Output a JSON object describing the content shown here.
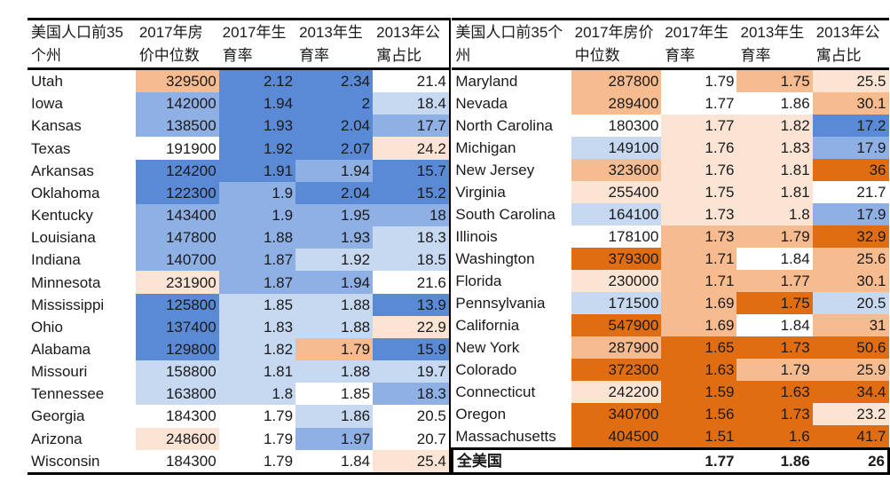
{
  "palette": {
    "D": "#5a8ad5",
    "M": "#8fb0e4",
    "L": "#c7d8f1",
    "W": "#ffffff",
    "P": "#fce4d5",
    "O": "#f6bb8f",
    "R": "#e06d12"
  },
  "chart_data": {
    "type": "table",
    "left": {
      "headers": [
        [
          "美国人口前35",
          "个州"
        ],
        [
          "2017年房",
          "价中位数"
        ],
        [
          "2017年生",
          "育率"
        ],
        [
          "2013年生",
          "育率"
        ],
        [
          "2013年公",
          "寓占比"
        ]
      ],
      "rows": [
        {
          "name": "Utah",
          "values": [
            "329500",
            "2.12",
            "2.34",
            "21.4"
          ],
          "colors": [
            "O",
            "D",
            "D",
            "W"
          ]
        },
        {
          "name": "Iowa",
          "values": [
            "142000",
            "1.94",
            "2",
            "18.4"
          ],
          "colors": [
            "M",
            "D",
            "D",
            "L"
          ]
        },
        {
          "name": "Kansas",
          "values": [
            "138500",
            "1.93",
            "2.04",
            "17.7"
          ],
          "colors": [
            "M",
            "D",
            "D",
            "M"
          ]
        },
        {
          "name": "Texas",
          "values": [
            "191900",
            "1.92",
            "2.07",
            "24.2"
          ],
          "colors": [
            "W",
            "D",
            "D",
            "P"
          ]
        },
        {
          "name": "Arkansas",
          "values": [
            "124200",
            "1.91",
            "1.94",
            "15.7"
          ],
          "colors": [
            "D",
            "D",
            "M",
            "D"
          ]
        },
        {
          "name": "Oklahoma",
          "values": [
            "122300",
            "1.9",
            "2.04",
            "15.2"
          ],
          "colors": [
            "D",
            "M",
            "D",
            "D"
          ]
        },
        {
          "name": "Kentucky",
          "values": [
            "143400",
            "1.9",
            "1.95",
            "18"
          ],
          "colors": [
            "M",
            "M",
            "M",
            "M"
          ]
        },
        {
          "name": "Louisiana",
          "values": [
            "147800",
            "1.88",
            "1.93",
            "18.3"
          ],
          "colors": [
            "M",
            "M",
            "M",
            "L"
          ]
        },
        {
          "name": "Indiana",
          "values": [
            "140700",
            "1.87",
            "1.92",
            "18.5"
          ],
          "colors": [
            "M",
            "M",
            "L",
            "L"
          ]
        },
        {
          "name": "Minnesota",
          "values": [
            "231900",
            "1.87",
            "1.94",
            "21.6"
          ],
          "colors": [
            "P",
            "M",
            "M",
            "W"
          ]
        },
        {
          "name": "Mississippi",
          "values": [
            "125800",
            "1.85",
            "1.88",
            "13.9"
          ],
          "colors": [
            "D",
            "L",
            "L",
            "D"
          ]
        },
        {
          "name": "Ohio",
          "values": [
            "137400",
            "1.83",
            "1.88",
            "22.9"
          ],
          "colors": [
            "D",
            "L",
            "L",
            "P"
          ]
        },
        {
          "name": "Alabama",
          "values": [
            "129800",
            "1.82",
            "1.79",
            "15.9"
          ],
          "colors": [
            "D",
            "L",
            "O",
            "D"
          ]
        },
        {
          "name": "Missouri",
          "values": [
            "158800",
            "1.81",
            "1.88",
            "19.7"
          ],
          "colors": [
            "L",
            "L",
            "L",
            "L"
          ]
        },
        {
          "name": "Tennessee",
          "values": [
            "163800",
            "1.8",
            "1.85",
            "18.3"
          ],
          "colors": [
            "L",
            "L",
            "W",
            "M"
          ]
        },
        {
          "name": "Georgia",
          "values": [
            "184300",
            "1.79",
            "1.86",
            "20.5"
          ],
          "colors": [
            "W",
            "W",
            "L",
            "W"
          ]
        },
        {
          "name": "Arizona",
          "values": [
            "248600",
            "1.79",
            "1.97",
            "20.7"
          ],
          "colors": [
            "P",
            "W",
            "M",
            "W"
          ]
        },
        {
          "name": "Wisconsin",
          "values": [
            "184300",
            "1.79",
            "1.84",
            "25.4"
          ],
          "colors": [
            "W",
            "W",
            "W",
            "P"
          ]
        }
      ]
    },
    "right": {
      "headers": [
        [
          "美国人口前35个",
          "州"
        ],
        [
          "2017年房价",
          "中位数"
        ],
        [
          "2017年生",
          "育率"
        ],
        [
          "2013年生",
          "育率"
        ],
        [
          "2013年公",
          "寓占比"
        ]
      ],
      "rows": [
        {
          "name": "Maryland",
          "values": [
            "287800",
            "1.79",
            "1.75",
            "25.5"
          ],
          "colors": [
            "O",
            "W",
            "O",
            "P"
          ]
        },
        {
          "name": "Nevada",
          "values": [
            "289400",
            "1.77",
            "1.86",
            "30.1"
          ],
          "colors": [
            "O",
            "W",
            "W",
            "O"
          ]
        },
        {
          "name": "North Carolina",
          "values": [
            "180300",
            "1.77",
            "1.82",
            "17.2"
          ],
          "colors": [
            "W",
            "P",
            "P",
            "D"
          ]
        },
        {
          "name": "Michigan",
          "values": [
            "149100",
            "1.76",
            "1.83",
            "17.9"
          ],
          "colors": [
            "L",
            "P",
            "P",
            "M"
          ]
        },
        {
          "name": "New Jersey",
          "values": [
            "323600",
            "1.76",
            "1.81",
            "36"
          ],
          "colors": [
            "O",
            "P",
            "P",
            "R"
          ]
        },
        {
          "name": "Virginia",
          "values": [
            "255400",
            "1.75",
            "1.81",
            "21.7"
          ],
          "colors": [
            "P",
            "P",
            "P",
            "W"
          ]
        },
        {
          "name": "South Carolina",
          "values": [
            "164100",
            "1.73",
            "1.8",
            "17.9"
          ],
          "colors": [
            "L",
            "P",
            "P",
            "M"
          ]
        },
        {
          "name": "Illinois",
          "values": [
            "178100",
            "1.73",
            "1.79",
            "32.9"
          ],
          "colors": [
            "W",
            "O",
            "O",
            "R"
          ]
        },
        {
          "name": "Washington",
          "values": [
            "379300",
            "1.71",
            "1.84",
            "25.6"
          ],
          "colors": [
            "R",
            "O",
            "W",
            "O"
          ]
        },
        {
          "name": "Florida",
          "values": [
            "230000",
            "1.71",
            "1.77",
            "30.1"
          ],
          "colors": [
            "P",
            "O",
            "O",
            "O"
          ]
        },
        {
          "name": "Pennsylvania",
          "values": [
            "171500",
            "1.69",
            "1.75",
            "20.5"
          ],
          "colors": [
            "L",
            "O",
            "R",
            "L"
          ]
        },
        {
          "name": "California",
          "values": [
            "547900",
            "1.69",
            "1.84",
            "31"
          ],
          "colors": [
            "R",
            "O",
            "W",
            "O"
          ]
        },
        {
          "name": "New York",
          "values": [
            "287900",
            "1.65",
            "1.73",
            "50.6"
          ],
          "colors": [
            "O",
            "R",
            "R",
            "R"
          ]
        },
        {
          "name": "Colorado",
          "values": [
            "372300",
            "1.63",
            "1.79",
            "25.9"
          ],
          "colors": [
            "R",
            "R",
            "O",
            "O"
          ]
        },
        {
          "name": "Connecticut",
          "values": [
            "242200",
            "1.59",
            "1.63",
            "34.4"
          ],
          "colors": [
            "P",
            "R",
            "R",
            "R"
          ]
        },
        {
          "name": "Oregon",
          "values": [
            "340700",
            "1.56",
            "1.73",
            "23.2"
          ],
          "colors": [
            "R",
            "R",
            "R",
            "P"
          ]
        },
        {
          "name": "Massachusetts",
          "values": [
            "404500",
            "1.51",
            "1.6",
            "41.7"
          ],
          "colors": [
            "R",
            "R",
            "R",
            "R"
          ]
        }
      ],
      "total": {
        "name": "全美国",
        "values": [
          "",
          "1.77",
          "1.86",
          "26"
        ]
      }
    }
  }
}
